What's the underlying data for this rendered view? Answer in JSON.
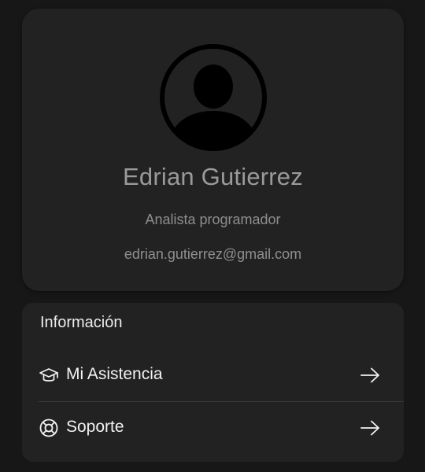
{
  "profile": {
    "name": "Edrian Gutierrez",
    "role": "Analista programador",
    "email": "edrian.gutierrez@gmail.com",
    "avatar_icon": "user-silhouette-icon"
  },
  "info": {
    "title": "Información",
    "items": [
      {
        "label": "Mi Asistencia",
        "icon": "graduation-cap-icon",
        "action_icon": "arrow-right-icon"
      },
      {
        "label": "Soporte",
        "icon": "lifebuoy-icon",
        "action_icon": "arrow-right-icon"
      }
    ]
  },
  "colors": {
    "background": "#171717",
    "card": "#222222",
    "name_text": "#9a9a9a",
    "secondary_text": "#8e8e8e",
    "primary_text": "#f2f2f2"
  }
}
